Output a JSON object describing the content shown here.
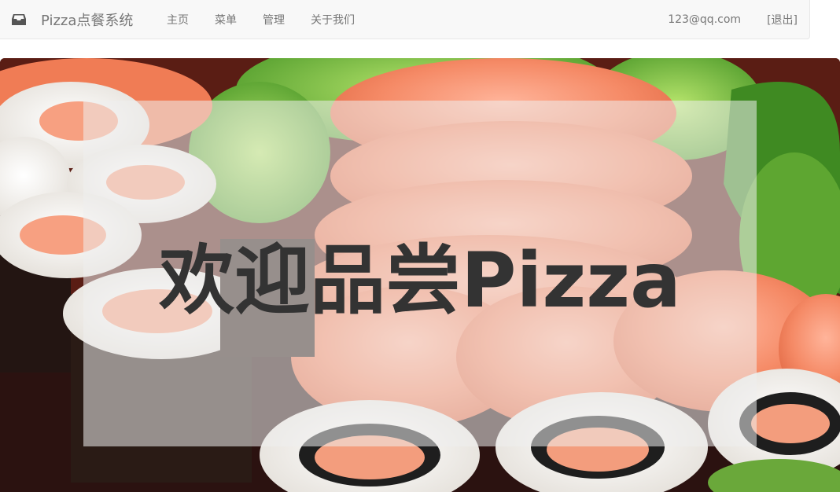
{
  "navbar": {
    "brand": "Pizza点餐系统",
    "brand_icon": "inbox-icon",
    "links": [
      "主页",
      "菜单",
      "管理",
      "关于我们"
    ],
    "user_email": "123@qq.com",
    "logout_label": "[退出]"
  },
  "hero": {
    "title": "欢迎品尝Pizza",
    "background": "sushi-salmon-photo"
  },
  "colors": {
    "navbar_bg": "#f8f8f8",
    "nav_text": "#777777",
    "hero_title": "#333333"
  }
}
